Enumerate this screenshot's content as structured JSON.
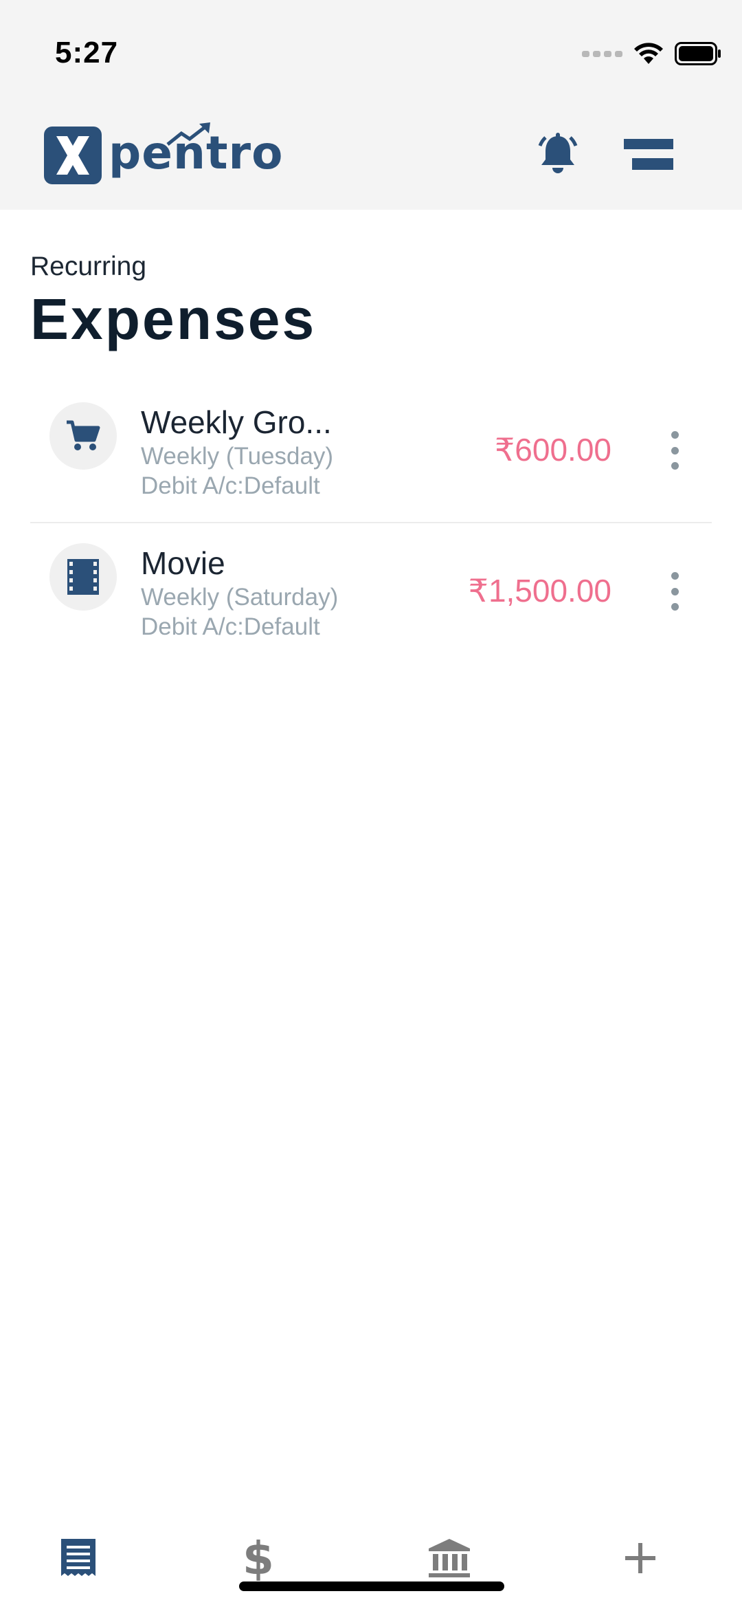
{
  "status_bar": {
    "time": "5:27"
  },
  "header": {
    "logo_text": "pentro",
    "logo_letter": "X",
    "brand_color": "#2b5079",
    "notification_icon": "bell-icon",
    "menu_icon": "menu-icon"
  },
  "page": {
    "subtitle": "Recurring",
    "title": "Expenses"
  },
  "expenses": [
    {
      "name": "Weekly Gro...",
      "frequency": "Weekly (Tuesday)",
      "account": "Debit A/c:Default",
      "amount": "₹600.00",
      "icon": "cart-icon"
    },
    {
      "name": "Movie",
      "frequency": "Weekly (Saturday)",
      "account": "Debit A/c:Default",
      "amount": "₹1,500.00",
      "icon": "film-icon"
    }
  ],
  "colors": {
    "amount": "#ef6f8e",
    "secondary_text": "#9aa7b0",
    "active_nav": "#2b5079",
    "inactive_nav": "#7d7d7d"
  },
  "bottom_nav": [
    {
      "name": "expenses-tab",
      "icon": "receipt-icon",
      "active": true
    },
    {
      "name": "income-tab",
      "icon": "dollar-icon",
      "label": "$",
      "active": false
    },
    {
      "name": "accounts-tab",
      "icon": "bank-icon",
      "active": false
    },
    {
      "name": "add-tab",
      "icon": "plus-icon",
      "active": false
    }
  ]
}
